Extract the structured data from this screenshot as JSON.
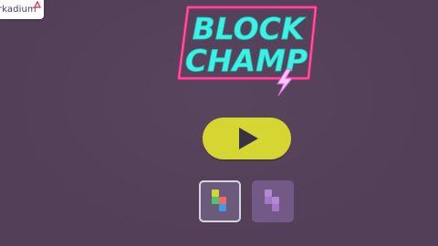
{
  "brand": {
    "partial_text": "rkadium",
    "icon": "arkadium-logo-icon"
  },
  "logo": {
    "line1": "BLOCK",
    "line2": "CHAMP",
    "icon": "lightning-bolt-icon",
    "colors": {
      "text": "#3ff0e4",
      "frame": "#ff2e8a",
      "bolt": "#f5c6ff"
    }
  },
  "play_button": {
    "icon": "play-icon",
    "color": "#d6d633"
  },
  "modes": [
    {
      "name": "classic-mode",
      "icon": "colored-blocks-icon",
      "selected": true
    },
    {
      "name": "purple-mode",
      "icon": "purple-blocks-icon",
      "selected": false
    }
  ],
  "colors": {
    "background": "#533f58"
  }
}
